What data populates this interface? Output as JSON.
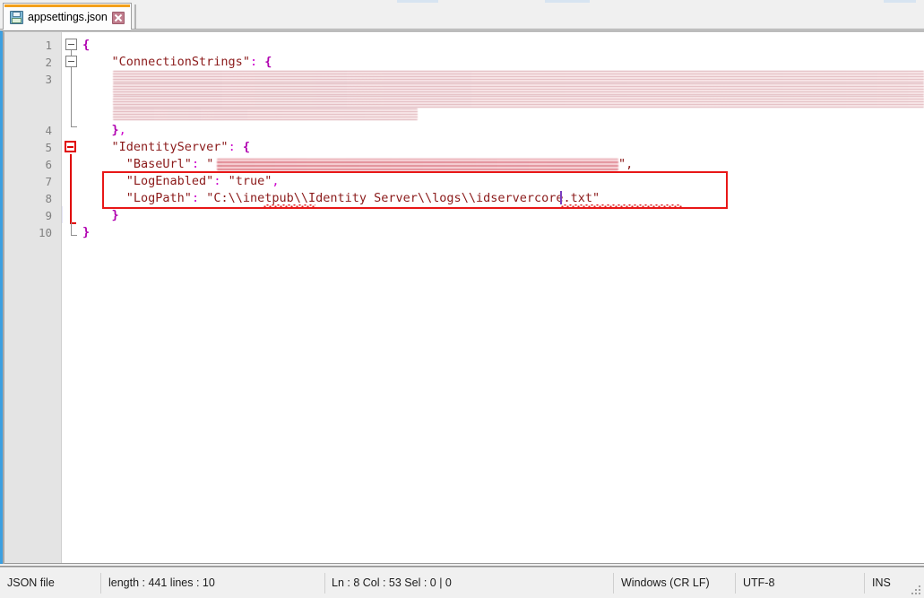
{
  "window": {
    "app": "Notepad++",
    "accent_orange": "#f2a01c",
    "accent_blue": "#3c9fe0",
    "annotation_color": "#e81717"
  },
  "tab": {
    "label": "appsettings.json",
    "save_icon": "floppy-disk-save-icon",
    "close_icon": "close-x-icon",
    "active": true
  },
  "editor": {
    "current_line": 8,
    "caret_col": 53,
    "lines": [
      {
        "number": "1",
        "text": "{",
        "redacted": false
      },
      {
        "number": "2",
        "text": "    \"ConnectionStrings\": {",
        "redacted": false
      },
      {
        "number": "3",
        "text": "",
        "redacted": true,
        "note": "connection-string-value-redacted"
      },
      {
        "number": "4",
        "text": "    },",
        "redacted": false
      },
      {
        "number": "5",
        "text": "    \"IdentityServer\": {",
        "redacted": false
      },
      {
        "number": "6",
        "text": "      \"BaseUrl\": \"",
        "redacted": true,
        "suffix": "\",",
        "note": "base-url-value-redacted"
      },
      {
        "number": "7",
        "text": "      \"LogEnabled\": \"true\",",
        "redacted": false
      },
      {
        "number": "8",
        "text": "      \"LogPath\": \"C:\\\\inetpub\\\\Identity Server\\\\logs\\\\idservercore.txt\"",
        "redacted": false
      },
      {
        "number": "9",
        "text": "    }",
        "redacted": false
      },
      {
        "number": "10",
        "text": "}",
        "redacted": false
      }
    ],
    "redacted_line3_ghost": [
      "\"IdentityServerContext\": \"Server=.;Initial Catalog=Perspective;Integrated",
      "Security=true;TrustServerCertificate=True;Pooling=false;MultipleActiveResultSets=true;En",
      "crypt=True;Connection Timeout=30;\""
    ],
    "spellcheck_words": [
      "inetpub",
      "idservercore.txt"
    ],
    "annotation": {
      "shape": "rectangle",
      "covers_lines": [
        7,
        8
      ],
      "color": "#e81717"
    }
  },
  "statusbar": {
    "file_type": "JSON file",
    "length_lines": "length : 441    lines : 10",
    "position": "Ln : 8    Col : 53    Sel : 0 | 0",
    "eol": "Windows (CR LF)",
    "encoding": "UTF-8",
    "insert_mode": "INS"
  }
}
